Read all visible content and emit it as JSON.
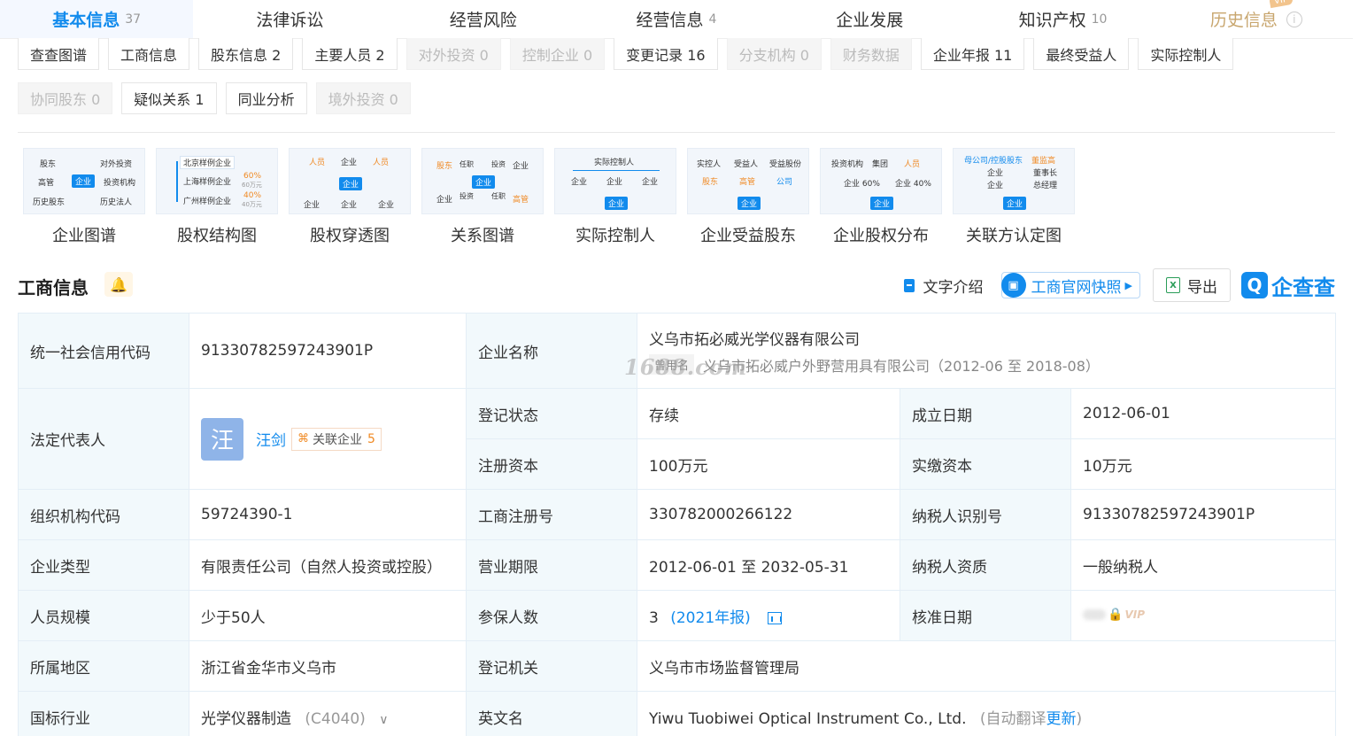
{
  "top_tabs": [
    {
      "label": "基本信息",
      "count": "37"
    },
    {
      "label": "法律诉讼",
      "count": ""
    },
    {
      "label": "经营风险",
      "count": ""
    },
    {
      "label": "经营信息",
      "count": "4"
    },
    {
      "label": "企业发展",
      "count": ""
    },
    {
      "label": "知识产权",
      "count": "10"
    },
    {
      "label": "历史信息",
      "count": "",
      "badge": "VIP"
    }
  ],
  "sub_tabs_row1": [
    {
      "label": "查查图谱"
    },
    {
      "label": "工商信息"
    },
    {
      "label": "股东信息 2"
    },
    {
      "label": "主要人员 2"
    },
    {
      "label": "对外投资 0"
    },
    {
      "label": "控制企业 0"
    },
    {
      "label": "变更记录 16"
    },
    {
      "label": "分支机构 0"
    },
    {
      "label": "财务数据"
    },
    {
      "label": "企业年报 11"
    },
    {
      "label": "最终受益人"
    },
    {
      "label": "实际控制人"
    }
  ],
  "sub_tabs_row2": [
    {
      "label": "协同股东 0"
    },
    {
      "label": "疑似关系 1"
    },
    {
      "label": "同业分析"
    },
    {
      "label": "境外投资 0"
    }
  ],
  "graphs": [
    {
      "label": "企业图谱"
    },
    {
      "label": "股权结构图"
    },
    {
      "label": "股权穿透图"
    },
    {
      "label": "关系图谱"
    },
    {
      "label": "实际控制人"
    },
    {
      "label": "企业受益股东"
    },
    {
      "label": "企业股权分布"
    },
    {
      "label": "关联方认定图"
    }
  ],
  "thumb_text": {
    "g1": [
      "股东",
      "对外投资",
      "高管",
      "企业",
      "投资机构",
      "历史股东",
      "历史法人"
    ],
    "g2": [
      "北京样例企业",
      "上海样例企业",
      "60%",
      "60万元",
      "广州样例企业",
      "40%",
      "40万元"
    ],
    "g3": [
      "人员",
      "企业",
      "人员",
      "企业",
      "企业",
      "企业",
      "企业"
    ],
    "g4": [
      "股东",
      "任职",
      "投资",
      "企业",
      "企业",
      "投资",
      "任职",
      "企业",
      "高管"
    ],
    "g5": [
      "实际控制人",
      "企业",
      "企业",
      "企业",
      "企业"
    ],
    "g6": [
      "实控人",
      "受益人",
      "受益股份",
      "股东",
      "高管",
      "公司",
      "企业"
    ],
    "g7": [
      "投资机构",
      "集团",
      "人员",
      "企业 60%",
      "企业 40%",
      "企业"
    ],
    "g8": [
      "母公司/控股股东",
      "董监高",
      "企业",
      "董事长",
      "企业",
      "总经理",
      "企业"
    ]
  },
  "section": {
    "title": "工商信息",
    "text_intro": "文字介绍",
    "snapshot": "工商官网快照",
    "export": "导出",
    "brand": "企查查"
  },
  "info": {
    "credit_code_label": "统一社会信用代码",
    "credit_code": "91330782597243901P",
    "name_label": "企业名称",
    "name": "义乌市拓必威光学仪器有限公司",
    "former_tag": "曾用名",
    "former_name": "义乌市拓必威户外野营用具有限公司（2012-06 至 2018-08）",
    "legal_label": "法定代表人",
    "legal_avatar": "汪",
    "legal_name": "汪剑",
    "legal_rel": "关联企业",
    "legal_rel_count": "5",
    "status_label": "登记状态",
    "status": "存续",
    "found_label": "成立日期",
    "found": "2012-06-01",
    "reg_cap_label": "注册资本",
    "reg_cap": "100万元",
    "paid_cap_label": "实缴资本",
    "paid_cap": "10万元",
    "org_code_label": "组织机构代码",
    "org_code": "59724390-1",
    "reg_no_label": "工商注册号",
    "reg_no": "330782000266122",
    "tax_id_label": "纳税人识别号",
    "tax_id": "91330782597243901P",
    "type_label": "企业类型",
    "type": "有限责任公司（自然人投资或控股）",
    "term_label": "营业期限",
    "term": "2012-06-01 至 2032-05-31",
    "tax_qual_label": "纳税人资质",
    "tax_qual": "一般纳税人",
    "size_label": "人员规模",
    "size": "少于50人",
    "insured_label": "参保人数",
    "insured": "3",
    "insured_note": "(2021年报)",
    "approve_label": "核准日期",
    "approve_vip": "VIP",
    "region_label": "所属地区",
    "region": "浙江省金华市义乌市",
    "authority_label": "登记机关",
    "authority": "义乌市市场监督管理局",
    "industry_label": "国标行业",
    "industry": "光学仪器制造",
    "industry_code": "(C4040)",
    "en_name_label": "英文名",
    "en_name": "Yiwu Tuobiwei Optical Instrument Co., Ltd.",
    "en_note": "(自动翻译",
    "en_update": "更新",
    "en_close": ")"
  },
  "watermark": "1688.com",
  "colors": {
    "accent": "#128bed",
    "label_bg": "#f2f9fc",
    "history": "#c8a66e",
    "orange": "#f08a24"
  }
}
